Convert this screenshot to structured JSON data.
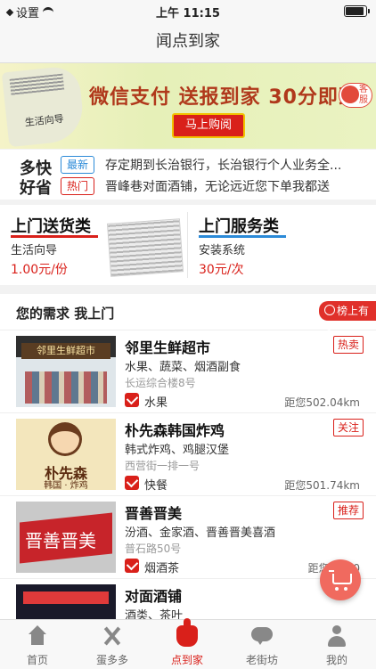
{
  "status": {
    "carrier": "设置",
    "time": "上午 11:15",
    "battery_level": 0.9
  },
  "nav": {
    "title": "闻点到家"
  },
  "banner": {
    "newspaper_label": "生活向导",
    "slogan": "微信支付  送报到家  30分即到",
    "buy_label": "马上购阅",
    "service_label": "客服"
  },
  "news": {
    "logo_line1": "多快",
    "logo_line2": "好省",
    "items": [
      {
        "tag": "最新",
        "text": "存定期到长治银行，长治银行个人业务全..."
      },
      {
        "tag": "热门",
        "text": "晋峰巷对面酒铺，无论远近您下单我都送"
      }
    ]
  },
  "categories": [
    {
      "title": "上门送货类",
      "sub": "生活向导",
      "price": "1.00元/份",
      "underline_color": "#d9201a"
    },
    {
      "title": "上门服务类",
      "sub": "安装系统",
      "price": "30元/次",
      "underline_color": "#2b8ad8"
    }
  ],
  "section": {
    "title": "您的需求 我上门",
    "rank_label": "榜上有名"
  },
  "shops": [
    {
      "name": "邻里生鲜超市",
      "desc": "水果、蔬菜、烟酒副食",
      "addr": "长运综合楼8号",
      "badge": "热卖",
      "category": "水果",
      "distance": "距您502.04km",
      "img_text": "邻里生鲜超市"
    },
    {
      "name": "朴先森韩国炸鸡",
      "desc": "韩式炸鸡、鸡腿汉堡",
      "addr": "西营街一排一号",
      "badge": "关注",
      "category": "快餐",
      "distance": "距您501.74km",
      "img_text1": "朴先森",
      "img_text2": "韩国 · 炸鸡"
    },
    {
      "name": "晋善晋美",
      "desc": "汾酒、金家酒、晋善晋美喜酒",
      "addr": "普石路50号",
      "badge": "推荐",
      "category": "烟酒茶",
      "distance": "距您502.0",
      "img_text": "晋善晋美"
    },
    {
      "name": "对面酒铺",
      "desc": "酒类、茶叶",
      "addr": "",
      "badge": "",
      "category": "",
      "distance": ""
    }
  ],
  "tabs": [
    {
      "label": "首页",
      "icon": "home-icon"
    },
    {
      "label": "蛋多多",
      "icon": "tools-icon"
    },
    {
      "label": "点到家",
      "icon": "tap-hand-icon"
    },
    {
      "label": "老街坊",
      "icon": "chat-icon"
    },
    {
      "label": "我的",
      "icon": "user-icon"
    }
  ],
  "colors": {
    "accent": "#d9201a",
    "blue": "#2b8ad8",
    "fab": "#f06a5f"
  }
}
